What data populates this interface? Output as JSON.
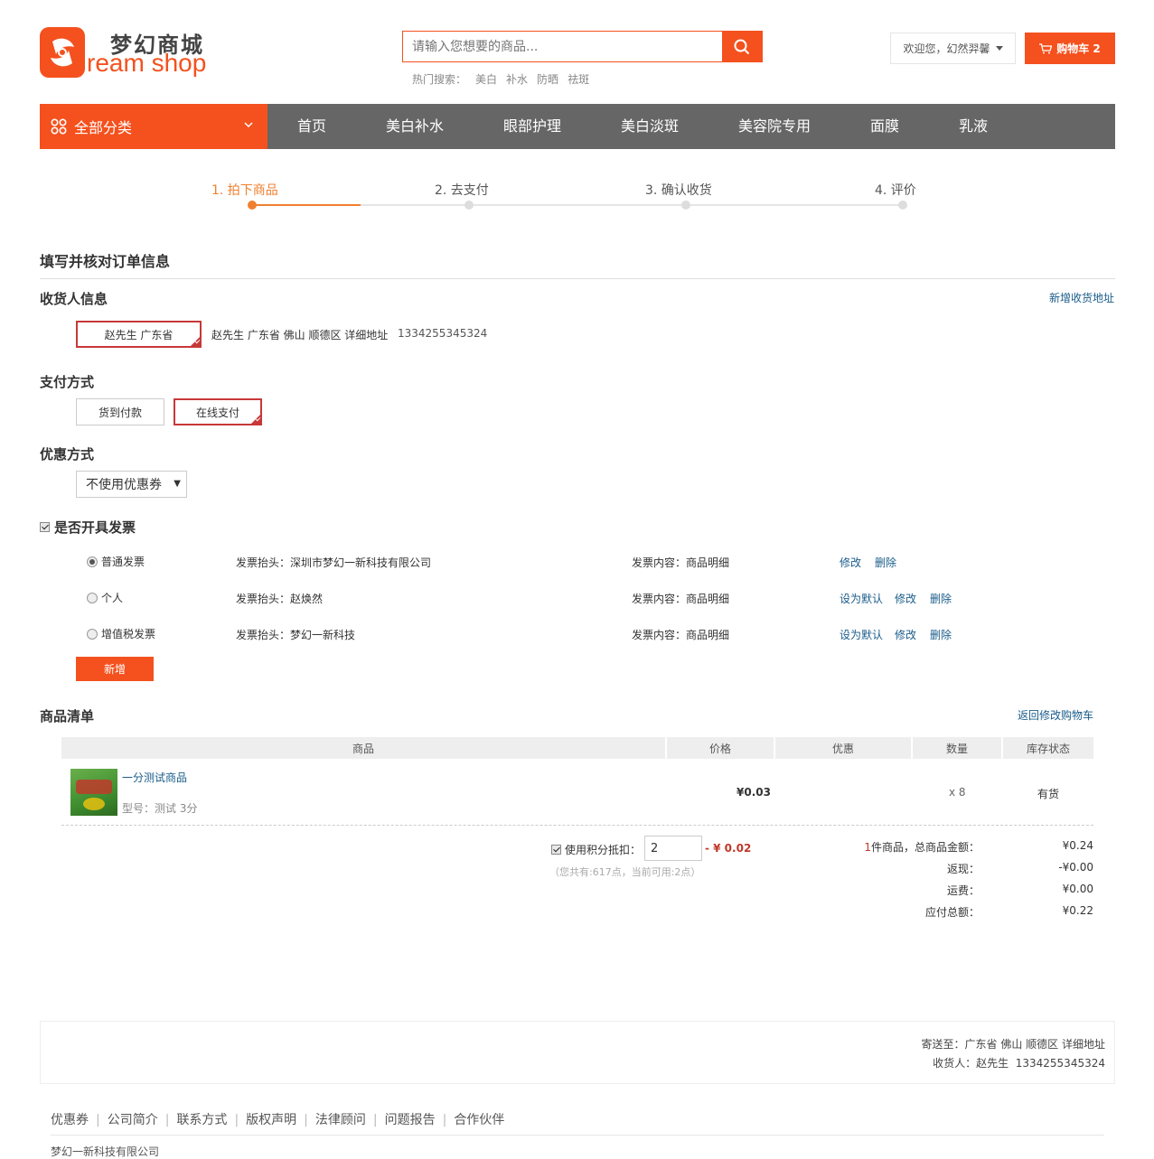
{
  "header": {
    "logo_cn": "梦幻商城",
    "logo_en": "ream shop",
    "search_placeholder": "请输入您想要的商品...",
    "hot_label": "热门搜索：",
    "hot_terms": [
      "美白",
      "补水",
      "防晒",
      "祛斑"
    ],
    "welcome": "欢迎您，幻然羿馨",
    "cart_label": "购物车 2"
  },
  "nav": {
    "all": "全部分类",
    "items": [
      "首页",
      "美白补水",
      "眼部护理",
      "美白淡斑",
      "美容院专用",
      "面膜",
      "乳液"
    ]
  },
  "steps": [
    "1. 拍下商品",
    "2. 去支付",
    "3. 确认收货",
    "4. 评价"
  ],
  "order": {
    "title": "填写并核对订单信息",
    "receiver_title": "收货人信息",
    "add_address": "新增收货地址",
    "addr_card": "赵先生 广东省",
    "addr_detail": "赵先生 广东省 佛山 顺德区 详细地址",
    "addr_phone": "1334255345324",
    "pay_title": "支付方式",
    "pay_options": [
      "货到付款",
      "在线支付"
    ],
    "coupon_title": "优惠方式",
    "coupon_selected": "不使用优惠券",
    "invoice_title": "是否开具发票",
    "invoices": [
      {
        "type": "普通发票",
        "head": "发票抬头：深圳市梦幻一新科技有限公司",
        "content": "发票内容：商品明细",
        "actions": [
          "修改",
          "删除"
        ]
      },
      {
        "type": "个人",
        "head": "发票抬头：赵焕然",
        "content": "发票内容：商品明细",
        "actions": [
          "设为默认",
          "修改",
          "删除"
        ]
      },
      {
        "type": "增值税发票",
        "head": "发票抬头：梦幻一新科技",
        "content": "发票内容：商品明细",
        "actions": [
          "设为默认",
          "修改",
          "删除"
        ]
      }
    ],
    "add_invoice": "新增"
  },
  "goods": {
    "title": "商品清单",
    "back_cart": "返回修改购物车",
    "columns": [
      "商品",
      "价格",
      "优惠",
      "数量",
      "库存状态"
    ],
    "item": {
      "name": "一分测试商品",
      "model": "型号：测试 3分",
      "price": "¥0.03",
      "qty": "x 8",
      "stock": "有货"
    },
    "points_label": "使用积分抵扣：",
    "points_value": "2",
    "points_discount": "- ¥ 0.02",
    "points_note": "（您共有:617点，当前可用:2点）",
    "summary": {
      "count_num": "1",
      "count_label": "件商品，总商品金额：",
      "total": "¥0.24",
      "rebate_label": "返现：",
      "rebate": "-¥0.00",
      "shipping_label": "运费：",
      "shipping": "¥0.00",
      "payable_label": "应付总额：",
      "payable": "¥0.22"
    }
  },
  "delivery": {
    "to": "寄送至：广东省 佛山 顺德区 详细地址",
    "receiver": "收货人：赵先生",
    "phone": "1334255345324"
  },
  "footer": {
    "links": [
      "优惠券",
      "公司简介",
      "联系方式",
      "版权声明",
      "法律顾问",
      "问题报告",
      "合作伙伴"
    ],
    "company": "梦幻一新科技有限公司"
  },
  "colors": {
    "accent": "#f4511e",
    "nav_bg": "#666666",
    "step_active": "#f08030",
    "link": "#1a5c8a",
    "price_red": "#c0392b"
  }
}
